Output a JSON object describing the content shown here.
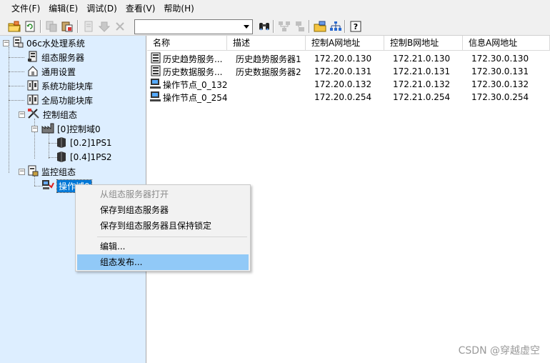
{
  "menubar": {
    "items": [
      "文件(F)",
      "编辑(E)",
      "调试(D)",
      "查看(V)",
      "帮助(H)"
    ]
  },
  "toolbar": {
    "combo_value": "",
    "icons": [
      "open-folder-icon",
      "refresh-icon",
      "copy-icon",
      "paste-icon",
      "document-icon",
      "download-icon",
      "delete-icon",
      "binoculars-icon",
      "network-icon",
      "network-alt-icon",
      "folder-stack-icon",
      "tree-icon",
      "help-icon"
    ]
  },
  "tree": {
    "root": "06c水处理系统",
    "items": {
      "config_server": "组态服务器",
      "general_settings": "通用设置",
      "system_function_library": "系统功能块库",
      "global_function_library": "全局功能块库",
      "control_config": "控制组态",
      "control_domain": "[0]控制域0",
      "ps1": "[0.2]1PS1",
      "ps2": "[0.4]1PS2",
      "monitor_config": "监控组态",
      "operator_domain": "操作域0"
    }
  },
  "list": {
    "columns": [
      "名称",
      "描述",
      "控制A网地址",
      "控制B网地址",
      "信息A网地址"
    ],
    "rows": [
      {
        "icon": "server-icon",
        "name": "历史趋势服务...",
        "desc": "历史趋势服务器1",
        "a": "172.20.0.130",
        "b": "172.21.0.130",
        "info": "172.30.0.130"
      },
      {
        "icon": "server-icon",
        "name": "历史数据服务...",
        "desc": "历史数据服务器2",
        "a": "172.20.0.131",
        "b": "172.21.0.131",
        "info": "172.30.0.131"
      },
      {
        "icon": "computer-icon",
        "name": "操作节点_0_132",
        "desc": "",
        "a": "172.20.0.132",
        "b": "172.21.0.132",
        "info": "172.30.0.132"
      },
      {
        "icon": "computer-icon",
        "name": "操作节点_0_254",
        "desc": "",
        "a": "172.20.0.254",
        "b": "172.21.0.254",
        "info": "172.30.0.254"
      }
    ]
  },
  "context_menu": {
    "open_from_server": "从组态服务器打开",
    "save_to_server": "保存到组态服务器",
    "save_and_lock": "保存到组态服务器且保持锁定",
    "edit": "编辑...",
    "publish": "组态发布..."
  },
  "watermark": "CSDN @穿越虚空",
  "colors": {
    "tree_bg": "#ddeeff",
    "selection": "#0078d7",
    "menu_highlight": "#91c9f7"
  }
}
